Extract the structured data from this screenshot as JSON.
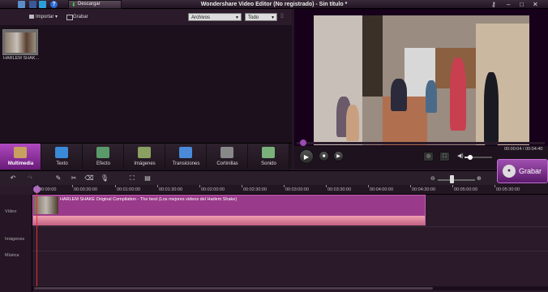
{
  "titlebar": {
    "title": "Wondershare Video Editor (No registrado) - Sin título *",
    "download_label": "Descargar"
  },
  "library_toolbar": {
    "import_label": "Importar",
    "record_label": "Grabar",
    "filter_files": "Archivos",
    "filter_all": "Todo"
  },
  "library": {
    "items": [
      {
        "label": "HARLEM SHAK..."
      }
    ]
  },
  "tabs": [
    {
      "label": "Multimedia",
      "active": true
    },
    {
      "label": "Texto"
    },
    {
      "label": "Efecto"
    },
    {
      "label": "Imágenes"
    },
    {
      "label": "Transiciones"
    },
    {
      "label": "Cortinillas"
    },
    {
      "label": "Sonido"
    }
  ],
  "player": {
    "timecode": "00:00:04 / 00:04:40",
    "record_button_label": "Grabar",
    "volume": 0.2,
    "progress": 0.015
  },
  "timeline": {
    "ruler": [
      "00:00:00",
      "00:00:30:00",
      "00:01:00:00",
      "00:01:30:00",
      "00:02:00:00",
      "00:02:30:00",
      "00:03:00:00",
      "00:03:30:00",
      "00:04:00:00",
      "00:04:30:00",
      "00:05:00:00",
      "00:05:30:00"
    ],
    "track_labels": {
      "video": "Vídeo",
      "images": "Imágenes",
      "music": "Música"
    },
    "clip_title": "HARLEM SHAKE Original Compilation - The best (Los mejores videos del Harlem Shake)",
    "zoom_level": 0.35
  },
  "colors": {
    "accent": "#b04ac0",
    "clip": "#9a3a8a",
    "playhead": "#e03030"
  }
}
